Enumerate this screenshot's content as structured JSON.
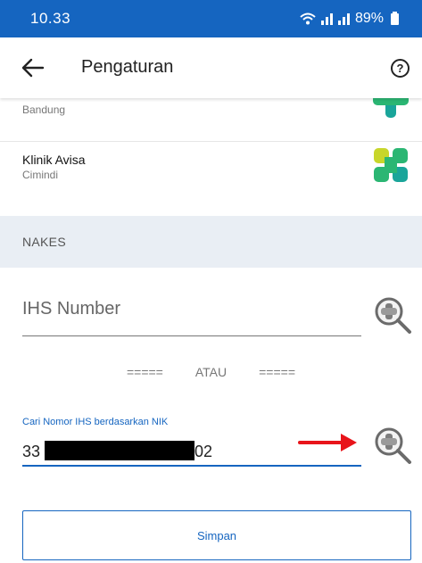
{
  "status_bar": {
    "time": "10.33",
    "battery": "89%"
  },
  "app_bar": {
    "title": "Pengaturan"
  },
  "clinics": [
    {
      "name": "",
      "location": "Bandung"
    },
    {
      "name": "Klinik Avisa",
      "location": "Cimindi"
    }
  ],
  "section": {
    "title": "NAKES"
  },
  "ihs": {
    "placeholder": "IHS Number",
    "value": ""
  },
  "divider": {
    "left": "=====",
    "text": "ATAU",
    "right": "====="
  },
  "nik": {
    "label": "Cari Nomor IHS berdasarkan NIK",
    "prefix": "33",
    "suffix": "02"
  },
  "save": {
    "label": "Simpan"
  },
  "colors": {
    "primary": "#1565c0",
    "section_bg": "#e9eef4",
    "arrow": "#e8141a",
    "logo_green": "#2bb673",
    "logo_yellow": "#c8d62b",
    "logo_teal": "#1aa59a"
  },
  "icons": {
    "back": "arrow-left-icon",
    "help": "help-circle-icon",
    "search": "magnifier-clinic-icon",
    "logo": "clinic-cross-logo"
  }
}
